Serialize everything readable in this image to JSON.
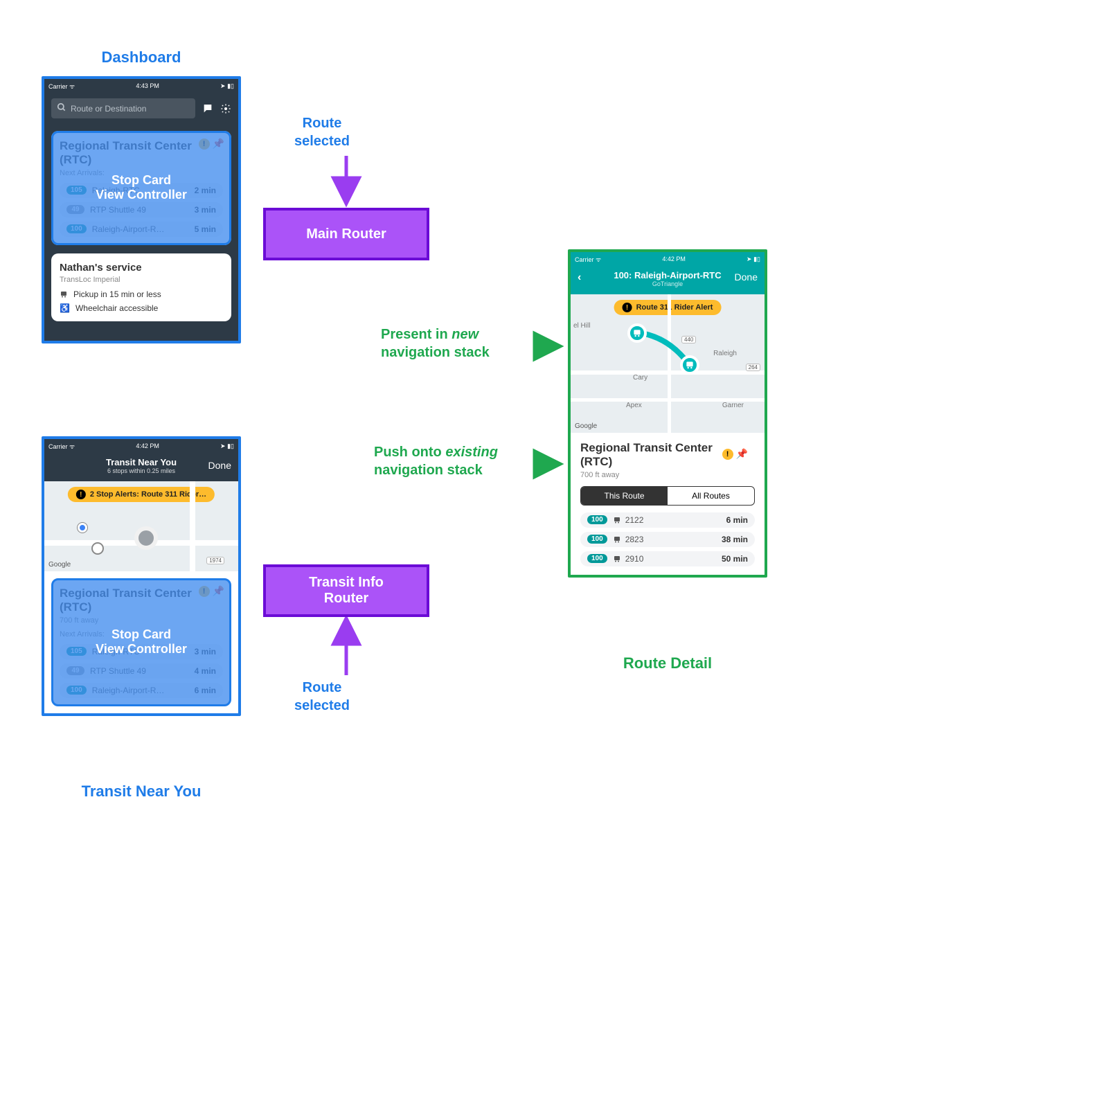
{
  "colors": {
    "blue": "#1f7ce8",
    "green": "#1fa84f",
    "purple": "#9a3df0",
    "teal": "#00a6a6",
    "badgeTeal": "#009999",
    "badgeGray": "#9aa0a6",
    "yellow": "#fdbb2d"
  },
  "labels": {
    "dashboard": "Dashboard",
    "transitNearYou": "Transit Near You",
    "routeDetail": "Route Detail",
    "mainRouter": "Main Router",
    "infoRouter": "Transit Info\nRouter",
    "routeSelected": "Route\nselected",
    "presentLine1": "Present in ",
    "presentEm": "new",
    "presentLine2": "navigation stack",
    "pushLine1": "Push onto ",
    "pushEm": "existing",
    "pushLine2": "navigation stack",
    "stopCardOverlay": "Stop Card\nView Controller"
  },
  "dashboard": {
    "statusTime": "4:43 PM",
    "carrier": "Carrier",
    "search_placeholder": "Route or Destination",
    "stopTitle": "Regional Transit Center (RTC)",
    "nextArrivals": "Next Arrivals:",
    "arrivals": [
      {
        "badge": "105",
        "color": "#009999",
        "name": "Raleigh-RTC",
        "time": "2 min"
      },
      {
        "badge": "49",
        "color": "#9aa0a6",
        "name": "RTP Shuttle 49",
        "time": "3 min"
      },
      {
        "badge": "100",
        "color": "#009999",
        "name": "Raleigh-Airport-R…",
        "time": "5 min"
      }
    ],
    "serviceTitle": "Nathan's service",
    "serviceSub": "TransLoc Imperial",
    "serviceLine1": "Pickup in 15 min or less",
    "serviceLine2": "Wheelchair accessible"
  },
  "nearYou": {
    "statusTime": "4:42 PM",
    "carrier": "Carrier",
    "title": "Transit Near You",
    "subtitle": "6 stops within 0.25 miles",
    "done": "Done",
    "alert": "2 Stop Alerts: Route 311 Rider…",
    "stopTitle": "Regional Transit Center (RTC)",
    "distance": "700 ft away",
    "nextArrivals": "Next Arrivals:",
    "arrivals": [
      {
        "badge": "105",
        "color": "#009999",
        "name": "Raleigh-RTC",
        "time": "3 min"
      },
      {
        "badge": "49",
        "color": "#9aa0a6",
        "name": "RTP Shuttle 49",
        "time": "4 min"
      },
      {
        "badge": "100",
        "color": "#009999",
        "name": "Raleigh-Airport-R…",
        "time": "6 min"
      }
    ],
    "mapPlaces": {
      "google": "Google",
      "road": "1974"
    }
  },
  "routeDetail": {
    "statusTime": "4:42 PM",
    "carrier": "Carrier",
    "title": "100: Raleigh-Airport-RTC",
    "subtitle": "GoTriangle",
    "done": "Done",
    "alert": "Route 311 Rider Alert",
    "mapPlaces": {
      "google": "Google",
      "hill": "el Hill",
      "cary": "Cary",
      "raleigh": "Raleigh",
      "apex": "Apex",
      "garner": "Garner",
      "r440": "440",
      "r264": "264"
    },
    "stopTitle": "Regional Transit Center (RTC)",
    "distance": "700 ft away",
    "segThis": "This Route",
    "segAll": "All Routes",
    "arrivals": [
      {
        "badge": "100",
        "vehicle": "2122",
        "time": "6 min"
      },
      {
        "badge": "100",
        "vehicle": "2823",
        "time": "38 min"
      },
      {
        "badge": "100",
        "vehicle": "2910",
        "time": "50 min"
      }
    ]
  }
}
